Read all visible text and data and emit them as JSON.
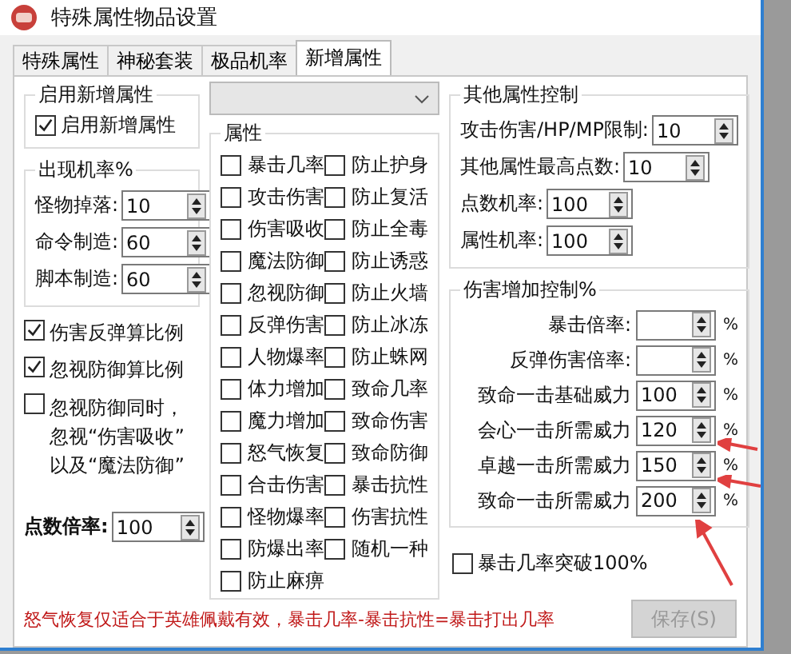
{
  "window": {
    "title": "特殊属性物品设置"
  },
  "tabs": [
    {
      "label": "特殊属性",
      "selected": false
    },
    {
      "label": "神秘套装",
      "selected": false
    },
    {
      "label": "极品机率",
      "selected": false
    },
    {
      "label": "新增属性",
      "selected": true
    }
  ],
  "enable_group": {
    "title": "启用新增属性",
    "checkbox": {
      "label": "启用新增属性",
      "checked": true
    }
  },
  "drop_rate_group": {
    "title": "出现机率%",
    "fields": [
      {
        "label": "怪物掉落:",
        "value": "10"
      },
      {
        "label": "命令制造:",
        "value": "60"
      },
      {
        "label": "脚本制造:",
        "value": "60"
      }
    ]
  },
  "options": [
    {
      "label": "伤害反弹算比例",
      "checked": true
    },
    {
      "label": "忽视防御算比例",
      "checked": true
    },
    {
      "lines": [
        "忽视防御同时，",
        "忽视“伤害吸收”",
        "以及“魔法防御”"
      ],
      "checked": false
    }
  ],
  "point_multiplier": {
    "label": "点数倍率:",
    "value": "100"
  },
  "attributes": {
    "title": "属性",
    "items": [
      {
        "label": "暴击几率",
        "checked": false
      },
      {
        "label": "防止护身",
        "checked": false
      },
      {
        "label": "攻击伤害",
        "checked": false
      },
      {
        "label": "防止复活",
        "checked": false
      },
      {
        "label": "伤害吸收",
        "checked": false
      },
      {
        "label": "防止全毒",
        "checked": false
      },
      {
        "label": "魔法防御",
        "checked": false
      },
      {
        "label": "防止诱惑",
        "checked": false
      },
      {
        "label": "忽视防御",
        "checked": false
      },
      {
        "label": "防止火墙",
        "checked": false
      },
      {
        "label": "反弹伤害",
        "checked": false
      },
      {
        "label": "防止冰冻",
        "checked": false
      },
      {
        "label": "人物爆率",
        "checked": false
      },
      {
        "label": "防止蛛网",
        "checked": false
      },
      {
        "label": "体力增加",
        "checked": false
      },
      {
        "label": "致命几率",
        "checked": false
      },
      {
        "label": "魔力增加",
        "checked": false
      },
      {
        "label": "致命伤害",
        "checked": false
      },
      {
        "label": "怒气恢复",
        "checked": false
      },
      {
        "label": "致命防御",
        "checked": false
      },
      {
        "label": "合击伤害",
        "checked": false
      },
      {
        "label": "暴击抗性",
        "checked": false
      },
      {
        "label": "怪物爆率",
        "checked": false
      },
      {
        "label": "伤害抗性",
        "checked": false
      },
      {
        "label": "防爆出率",
        "checked": false
      },
      {
        "label": "随机一种",
        "checked": false
      },
      {
        "label": "防止麻痹",
        "checked": false
      }
    ]
  },
  "other_control": {
    "title": "其他属性控制",
    "fields": [
      {
        "label": "攻击伤害/HP/MP限制:",
        "value": "10"
      },
      {
        "label": "其他属性最高点数:",
        "value": "10"
      },
      {
        "label": "点数机率:",
        "value": "100"
      },
      {
        "label": "属性机率:",
        "value": "100"
      }
    ]
  },
  "damage_control": {
    "title": "伤害增加控制%",
    "fields": [
      {
        "label": "暴击倍率:",
        "unit": "%"
      },
      {
        "label": "反弹伤害倍率:",
        "unit": "%"
      },
      {
        "label": "致命一击基础威力",
        "value": "100",
        "unit": "%"
      },
      {
        "label": "会心一击所需威力",
        "value": "120",
        "unit": "%"
      },
      {
        "label": "卓越一击所需威力",
        "value": "150",
        "unit": "%"
      },
      {
        "label": "致命一击所需威力",
        "value": "200",
        "unit": "%"
      }
    ]
  },
  "crit_breakthrough": {
    "label": "暴击几率突破100%",
    "checked": false
  },
  "note": "怒气恢复仅适合于英雄佩戴有效，暴击几率-暴击抗性=暴击打出几率",
  "save_button": {
    "label": "保存(S)",
    "disabled": true
  }
}
